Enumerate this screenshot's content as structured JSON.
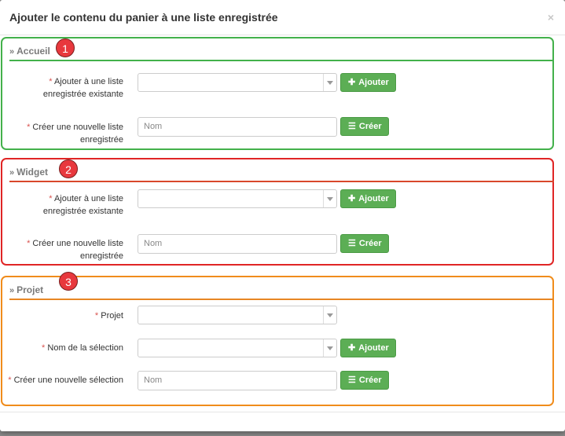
{
  "modal": {
    "title": "Ajouter le contenu du panier à une liste enregistrée",
    "close": "×"
  },
  "sections": [
    {
      "legend": "Accueil",
      "badge": "1",
      "color": "#43b14b",
      "add_label_line1": "Ajouter à une liste",
      "add_label_line2": "enregistrée existante",
      "add_button": "Ajouter",
      "create_label_line1": "Créer une nouvelle liste",
      "create_label_line2": "enregistrée",
      "create_placeholder": "Nom",
      "create_button": "Créer"
    },
    {
      "legend": "Widget",
      "badge": "2",
      "color": "#e02525",
      "add_label_line1": "Ajouter à une liste",
      "add_label_line2": "enregistrée existante",
      "add_button": "Ajouter",
      "create_label_line1": "Créer une nouvelle liste",
      "create_label_line2": "enregistrée",
      "create_placeholder": "Nom",
      "create_button": "Créer"
    },
    {
      "legend": "Projet",
      "badge": "3",
      "color": "#f08c1b",
      "projet_label": "Projet",
      "selection_label": "Nom de la sélection",
      "add_button": "Ajouter",
      "create_label": "Créer une nouvelle sélection",
      "create_placeholder": "Nom",
      "create_button": "Créer"
    }
  ],
  "required_marker": "*",
  "icons": {
    "legend": "double-chevron-right-icon",
    "add": "plus-icon",
    "create": "list-icon",
    "dropdown": "caret-down-icon",
    "close": "close-icon"
  }
}
